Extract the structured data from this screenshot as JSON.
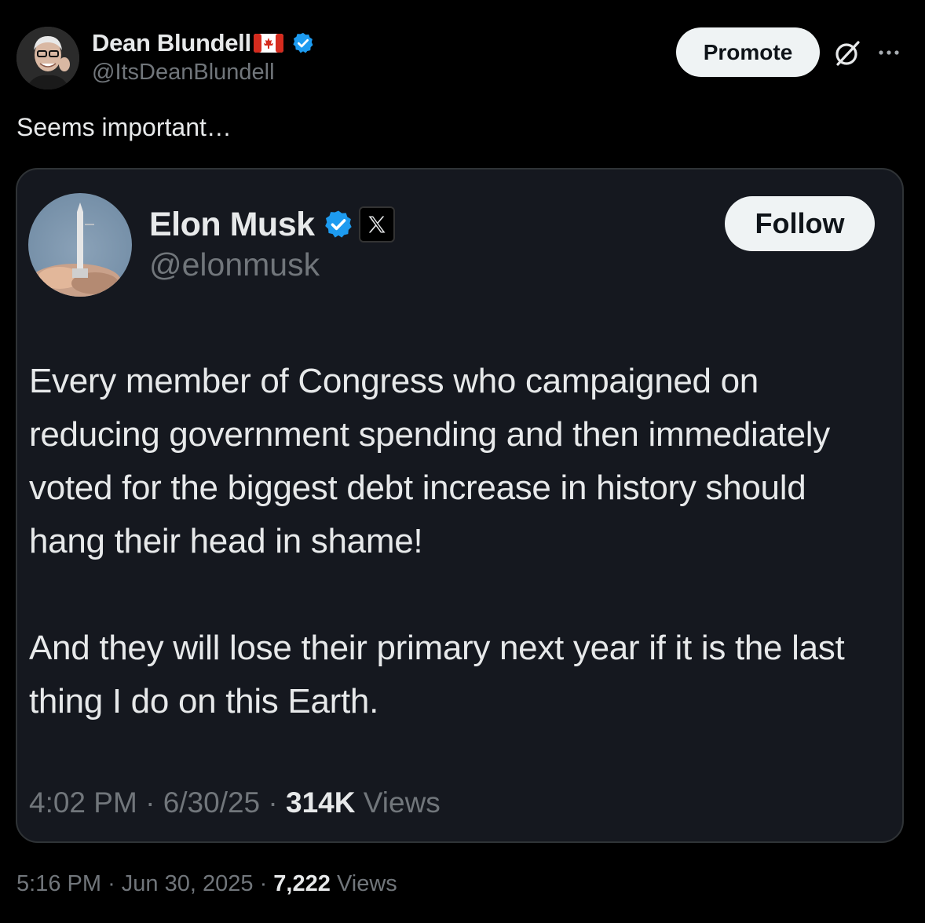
{
  "author": {
    "name": "Dean Blundell",
    "handle": "@ItsDeanBlundell",
    "flag_icon": "canada-flag-icon",
    "verified_icon": "verified-badge-icon"
  },
  "actions": {
    "promote_label": "Promote",
    "grok_icon": "grok-icon",
    "more_icon": "more-icon"
  },
  "tweet_text": "Seems important…",
  "quoted": {
    "name": "Elon Musk",
    "handle": "@elonmusk",
    "affiliation_icon": "x-logo-icon",
    "follow_label": "Follow",
    "paragraphs": [
      "Every member of Congress who campaigned on reducing government spending and then immediately voted for the biggest debt increase in history should hang their head in shame!",
      "And they will lose their primary next year if it is the last thing I do on this Earth."
    ],
    "time": "4:02 PM",
    "date": "6/30/25",
    "views_count": "314K",
    "views_label": "Views"
  },
  "meta": {
    "time": "5:16 PM",
    "date": "Jun 30, 2025",
    "views_count": "7,222",
    "views_label": "Views",
    "separator": "·"
  },
  "colors": {
    "background": "#000000",
    "quote_background": "#15181f",
    "text_primary": "#e7e9ea",
    "text_secondary": "#71767b",
    "verified_blue": "#1d9bf0",
    "button_bg": "#eff3f4"
  }
}
